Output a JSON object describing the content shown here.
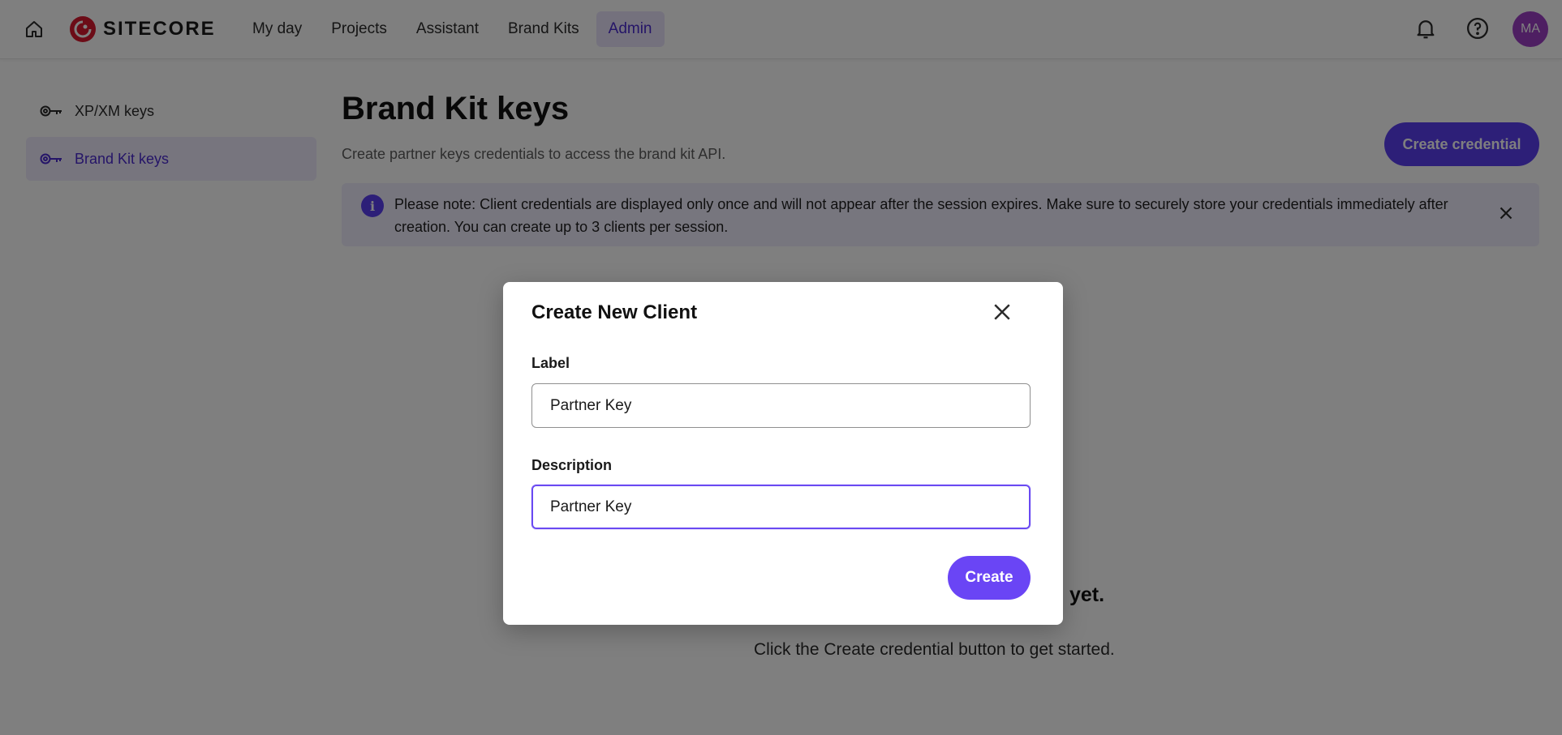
{
  "app": {
    "brand": "SITECORE"
  },
  "nav": {
    "items": [
      {
        "label": "My day"
      },
      {
        "label": "Projects"
      },
      {
        "label": "Assistant"
      },
      {
        "label": "Brand Kits"
      },
      {
        "label": "Admin",
        "active": true
      }
    ]
  },
  "header": {
    "avatar_initials": "MA",
    "icons": [
      "home-icon",
      "bell-icon",
      "help-icon"
    ]
  },
  "sidebar": {
    "items": [
      {
        "label": "XP/XM keys",
        "icon": "key-icon"
      },
      {
        "label": "Brand Kit keys",
        "icon": "key-icon",
        "active": true
      }
    ]
  },
  "main": {
    "title": "Brand Kit keys",
    "subtitle": "Create partner keys credentials to access the brand kit API.",
    "create_credential_label": "Create credential",
    "notice": "Please note: Client credentials are displayed only once and will not appear after the session expires. Make sure to securely store your credentials immediately after creation. You can create up to 3 clients per session.",
    "empty_title_visible": "yet.",
    "empty_subtitle": "Click the Create credential button to get started."
  },
  "modal": {
    "title": "Create New Client",
    "label_field": {
      "label": "Label",
      "value": "Partner Key"
    },
    "description_field": {
      "label": "Description",
      "value": "Partner Key"
    },
    "create_label": "Create"
  },
  "colors": {
    "accent": "#5b3ff0",
    "active_nav_bg": "#e8e3fb",
    "notice_bg": "#efecfd",
    "brand_red": "#d8182f",
    "avatar_bg": "#9c3fc4"
  }
}
